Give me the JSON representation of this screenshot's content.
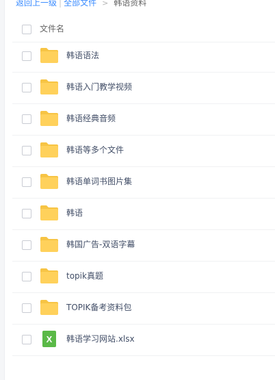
{
  "breadcrumb": {
    "back_label": "返回上一级",
    "bar": "|",
    "all_files_label": "全部文件",
    "arrow": ">",
    "current_label": "韩语资料"
  },
  "header": {
    "column_label": "文件名"
  },
  "files": [
    {
      "name": "韩语语法",
      "type": "folder-icon"
    },
    {
      "name": "韩语入门教学视频",
      "type": "folder-icon"
    },
    {
      "name": "韩语经典音频",
      "type": "folder-icon"
    },
    {
      "name": "韩语等多个文件",
      "type": "folder-icon"
    },
    {
      "name": "韩语单词书图片集",
      "type": "folder-icon"
    },
    {
      "name": "韩语",
      "type": "folder-icon"
    },
    {
      "name": "韩国广告-双语字幕",
      "type": "folder-icon"
    },
    {
      "name": "topik真题",
      "type": "folder-icon"
    },
    {
      "name": "TOPIK备考资料包",
      "type": "folder-icon"
    },
    {
      "name": "韩语学习网站.xlsx",
      "type": "excel-file-icon",
      "badge": "X"
    }
  ],
  "colors": {
    "link": "#3b8cff",
    "folder": "#ffd15b",
    "folder_tab": "#f7c444",
    "excel": "#5ab947",
    "text": "#424e67"
  }
}
